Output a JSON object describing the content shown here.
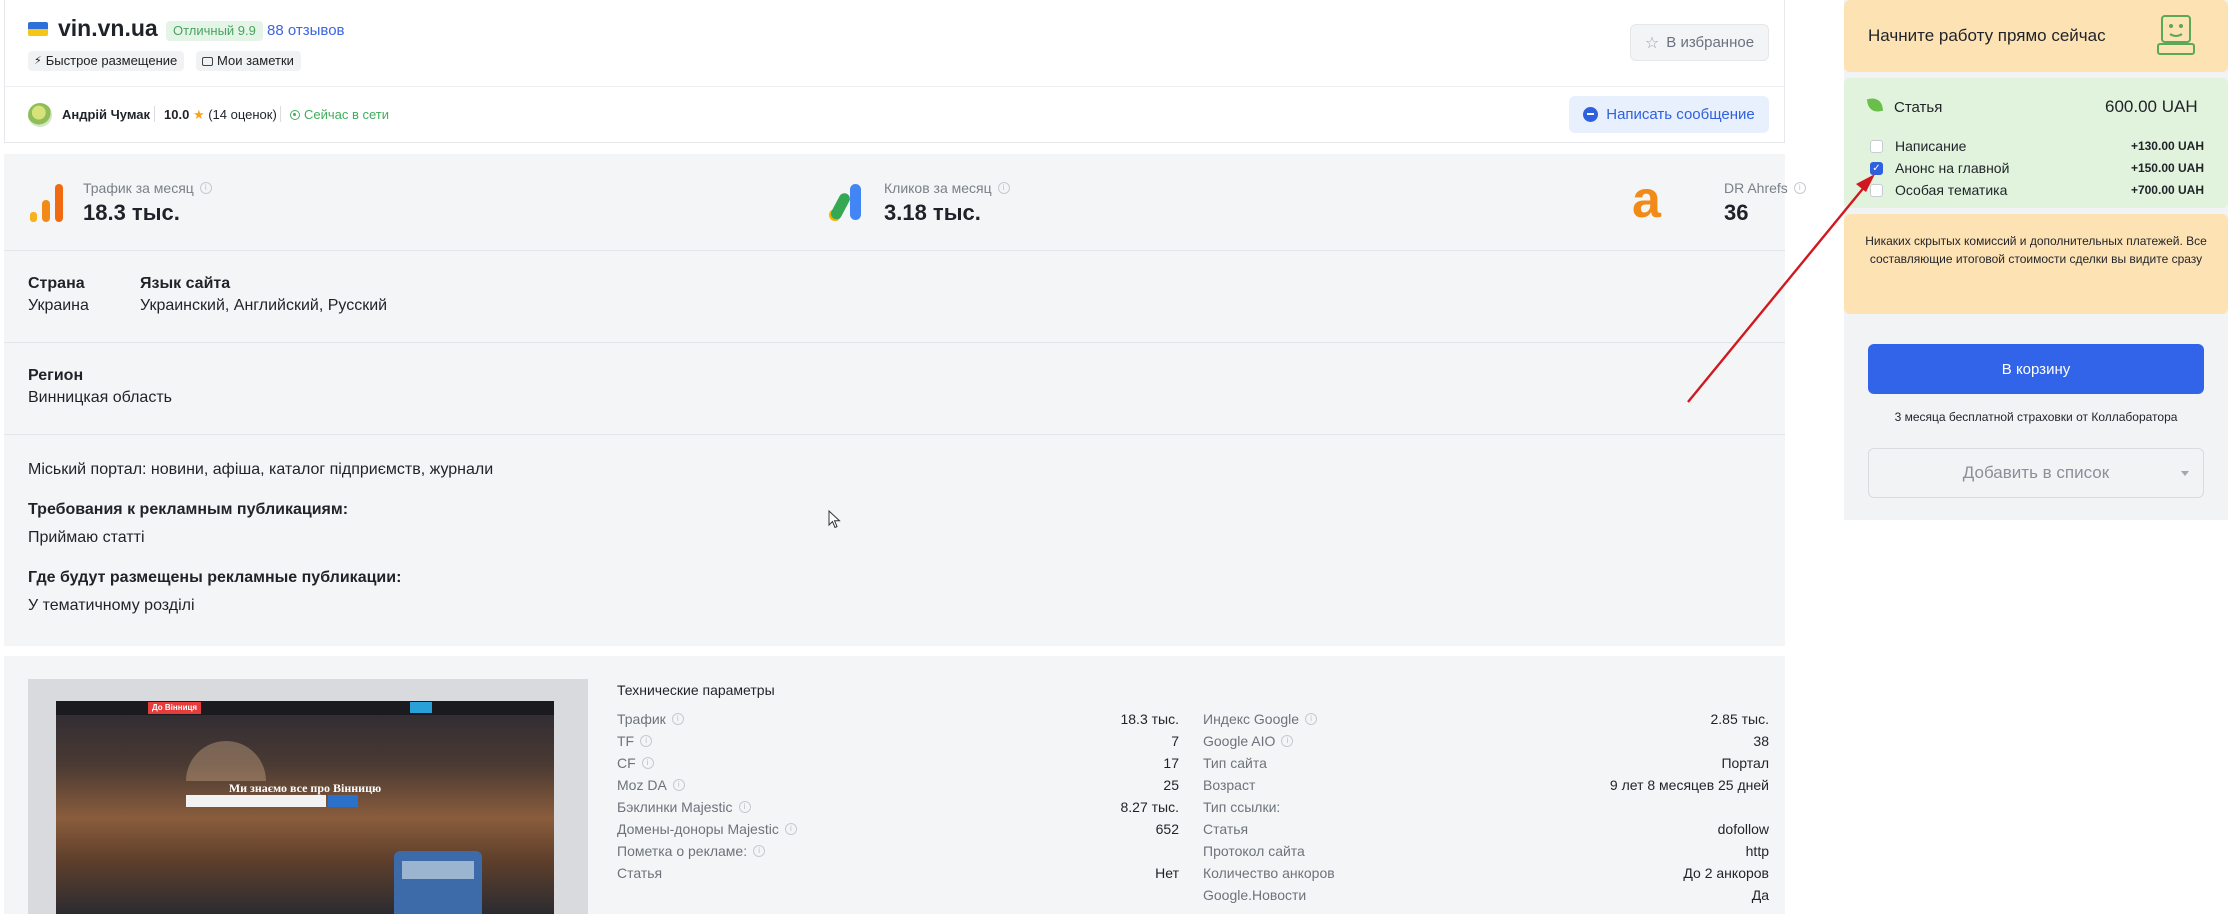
{
  "header": {
    "site_name": "vin.vn.ua",
    "rating_badge": "Отличный 9.9",
    "reviews_link": "88 отзывов",
    "chips": [
      "Быстрое размещение",
      "Мои заметки"
    ],
    "favorite_label": "В избранное"
  },
  "author": {
    "name": "Андрій Чумак",
    "score": "10.0",
    "ratings_count": "(14 оценок)",
    "status": "Сейчас в сети",
    "message_button": "Написать сообщение"
  },
  "metrics": [
    {
      "title": "Трафик за месяц",
      "value": "18.3 тыс.",
      "icon": "traffic-bars-icon"
    },
    {
      "title": "Кликов за месяц",
      "value": "3.18 тыс.",
      "icon": "google-ads-icon"
    },
    {
      "title": "DR Ahrefs",
      "value": "36",
      "icon": "ahrefs-icon"
    }
  ],
  "details": {
    "country_label": "Страна",
    "country_value": "Украина",
    "language_label": "Язык сайта",
    "language_value": "Украинский, Английский, Русский",
    "region_label": "Регион",
    "region_value": "Винницкая область",
    "description": "Міський портал: новини, афіша, каталог підприємств, журнали",
    "requirements_label": "Требования к рекламным публикациям:",
    "requirements_value": "Приймаю статті",
    "placement_label": "Где будут размещены рекламные публикации:",
    "placement_value": "У тематичному розділі"
  },
  "screenshot": {
    "logo": "До Вінниця",
    "tagline": "Ми знаємо все про Вінницю"
  },
  "tech": {
    "title": "Технические параметры",
    "left": [
      {
        "label": "Трафик",
        "value": "18.3 тыс.",
        "info": true
      },
      {
        "label": "TF",
        "value": "7",
        "info": true
      },
      {
        "label": "CF",
        "value": "17",
        "info": true
      },
      {
        "label": "Moz DA",
        "value": "25",
        "info": true
      },
      {
        "label": "Бэклинки Majestic",
        "value": "8.27 тыс.",
        "info": true
      },
      {
        "label": "Домены-доноры Majestic",
        "value": "652",
        "info": true
      },
      {
        "label": "Пометка о рекламе:",
        "value": "",
        "info": true
      },
      {
        "label": "Статья",
        "value": "Нет",
        "info": false
      }
    ],
    "right": [
      {
        "label": "Индекс Google",
        "value": "2.85 тыс.",
        "info": true
      },
      {
        "label": "Google AIO",
        "value": "38",
        "info": true
      },
      {
        "label": "Тип сайта",
        "value": "Портал",
        "info": false
      },
      {
        "label": "Возраст",
        "value": "9 лет 8 месяцев 25 дней",
        "info": false
      },
      {
        "label": "Тип ссылки:",
        "value": "",
        "info": false
      },
      {
        "label": "Статья",
        "value": "dofollow",
        "info": false
      },
      {
        "label": "Протокол сайта",
        "value": "http",
        "info": false
      },
      {
        "label": "Количество анкоров",
        "value": "До 2 анкоров",
        "info": false
      },
      {
        "label": "Google.Новости",
        "value": "Да",
        "info": false
      }
    ]
  },
  "sidebar": {
    "start_text": "Начните работу прямо сейчас",
    "product_name": "Статья",
    "product_price": "600.00 UAH",
    "options": [
      {
        "label": "Написание",
        "price": "+130.00 UAH",
        "checked": false
      },
      {
        "label": "Анонс на главной",
        "price": "+150.00 UAH",
        "checked": true
      },
      {
        "label": "Особая тематика",
        "price": "+700.00 UAH",
        "checked": false
      }
    ],
    "notice": "Никаких скрытых комиссий и дополнительных платежей. Все составляющие итоговой стоимости сделки вы видите сразу",
    "cart_button": "В корзину",
    "insurance": "3 месяца бесплатной страховки от Коллаборатора",
    "list_button": "Добавить в список"
  },
  "colors": {
    "accent_blue": "#3264ea",
    "link_blue": "#3d66e0",
    "online_green": "#3fae5b",
    "ahrefs_orange": "#f28a18",
    "peach": "#fde2b4",
    "mint": "#e1f3dc",
    "arrow_red": "#d0191e"
  }
}
